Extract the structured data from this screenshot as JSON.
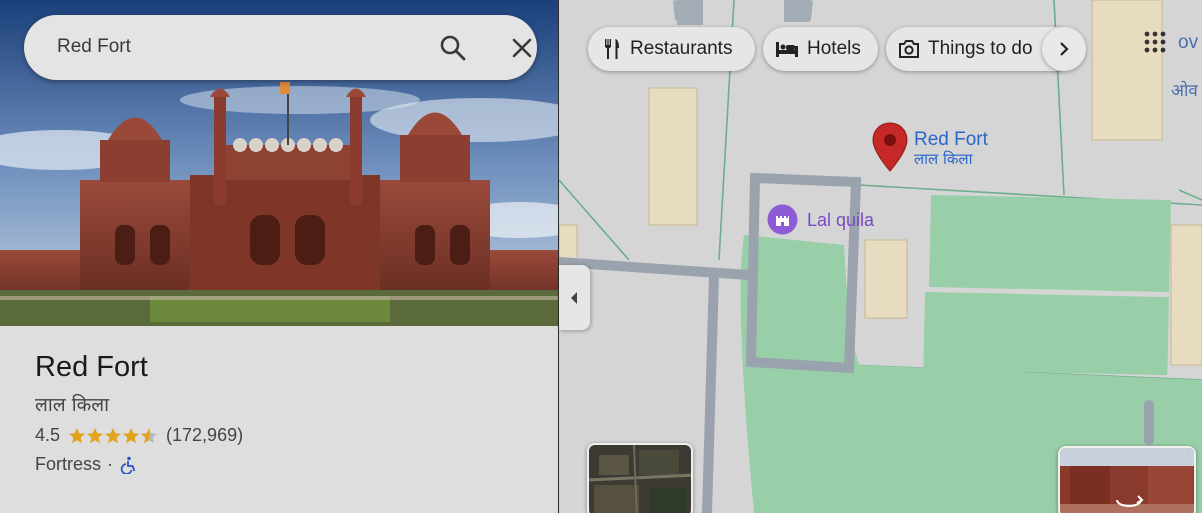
{
  "search": {
    "query": "Red Fort"
  },
  "place": {
    "title": "Red Fort",
    "subtitle": "लाल किला",
    "rating": "4.5",
    "stars_value": 4.5,
    "review_count": "(172,969)",
    "category": "Fortress",
    "separator": "·"
  },
  "chips": {
    "restaurants": "Restaurants",
    "hotels": "Hotels",
    "things_to_do": "Things to do"
  },
  "map": {
    "pin_label_en": "Red Fort",
    "pin_label_hi": "लाल किला",
    "poi_label": "Lal quila",
    "corner_label_a": "ov",
    "corner_label_b": "ओव"
  },
  "colors": {
    "pin": "#c62828",
    "pin_label": "#2a66c9",
    "poi": "#8e5bd6",
    "star": "#e2a21c",
    "park": "#98cfa8",
    "road_outline": "#9aa3ad",
    "building": "#e8dcc0"
  },
  "icons": {
    "search": "search-icon",
    "close": "close-icon",
    "restaurants": "fork-knife-icon",
    "hotels": "bed-icon",
    "things_to_do": "camera-icon",
    "more": "chevron-right-icon",
    "apps": "apps-grid-icon",
    "collapse": "chevron-left-icon",
    "wheelchair": "wheelchair-icon",
    "pin": "map-pin-icon",
    "poi": "castle-icon"
  }
}
